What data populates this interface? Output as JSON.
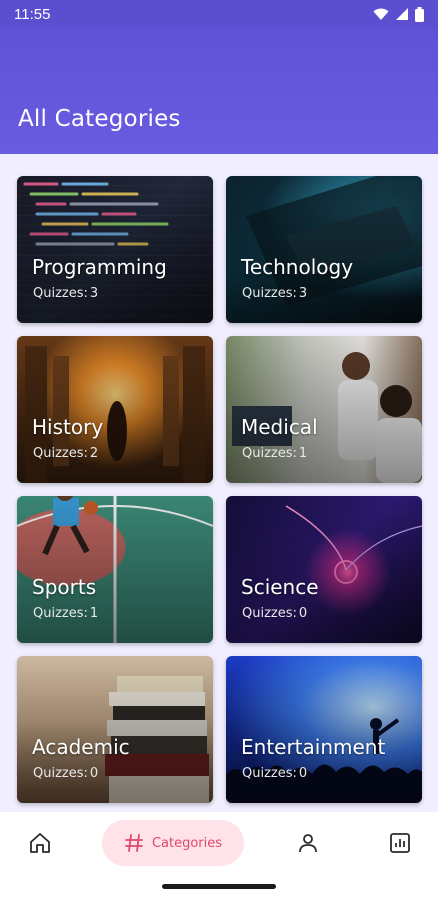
{
  "status_bar": {
    "time": "11:55"
  },
  "app_bar": {
    "title": "All Categories"
  },
  "categories": [
    {
      "title": "Programming",
      "count_label": "Quizzes:",
      "count": "3"
    },
    {
      "title": "Technology",
      "count_label": "Quizzes:",
      "count": "3"
    },
    {
      "title": "History",
      "count_label": "Quizzes:",
      "count": "2"
    },
    {
      "title": "Medical",
      "count_label": "Quizzes:",
      "count": "1"
    },
    {
      "title": "Sports",
      "count_label": "Quizzes:",
      "count": "1"
    },
    {
      "title": "Science",
      "count_label": "Quizzes:",
      "count": "0"
    },
    {
      "title": "Academic",
      "count_label": "Quizzes:",
      "count": "0"
    },
    {
      "title": "Entertainment",
      "count_label": "Quizzes:",
      "count": "0"
    }
  ],
  "bottom_nav": {
    "items": [
      {
        "icon": "home-icon"
      },
      {
        "icon": "hash-icon",
        "label": "Categories"
      },
      {
        "icon": "person-icon"
      },
      {
        "icon": "bar-chart-icon"
      }
    ],
    "selected": 1
  },
  "colors": {
    "app_bar": "#5f52d6",
    "background": "#f1efff",
    "nav_active_bg": "#ffe3e9",
    "nav_active_fg": "#e0476d"
  }
}
